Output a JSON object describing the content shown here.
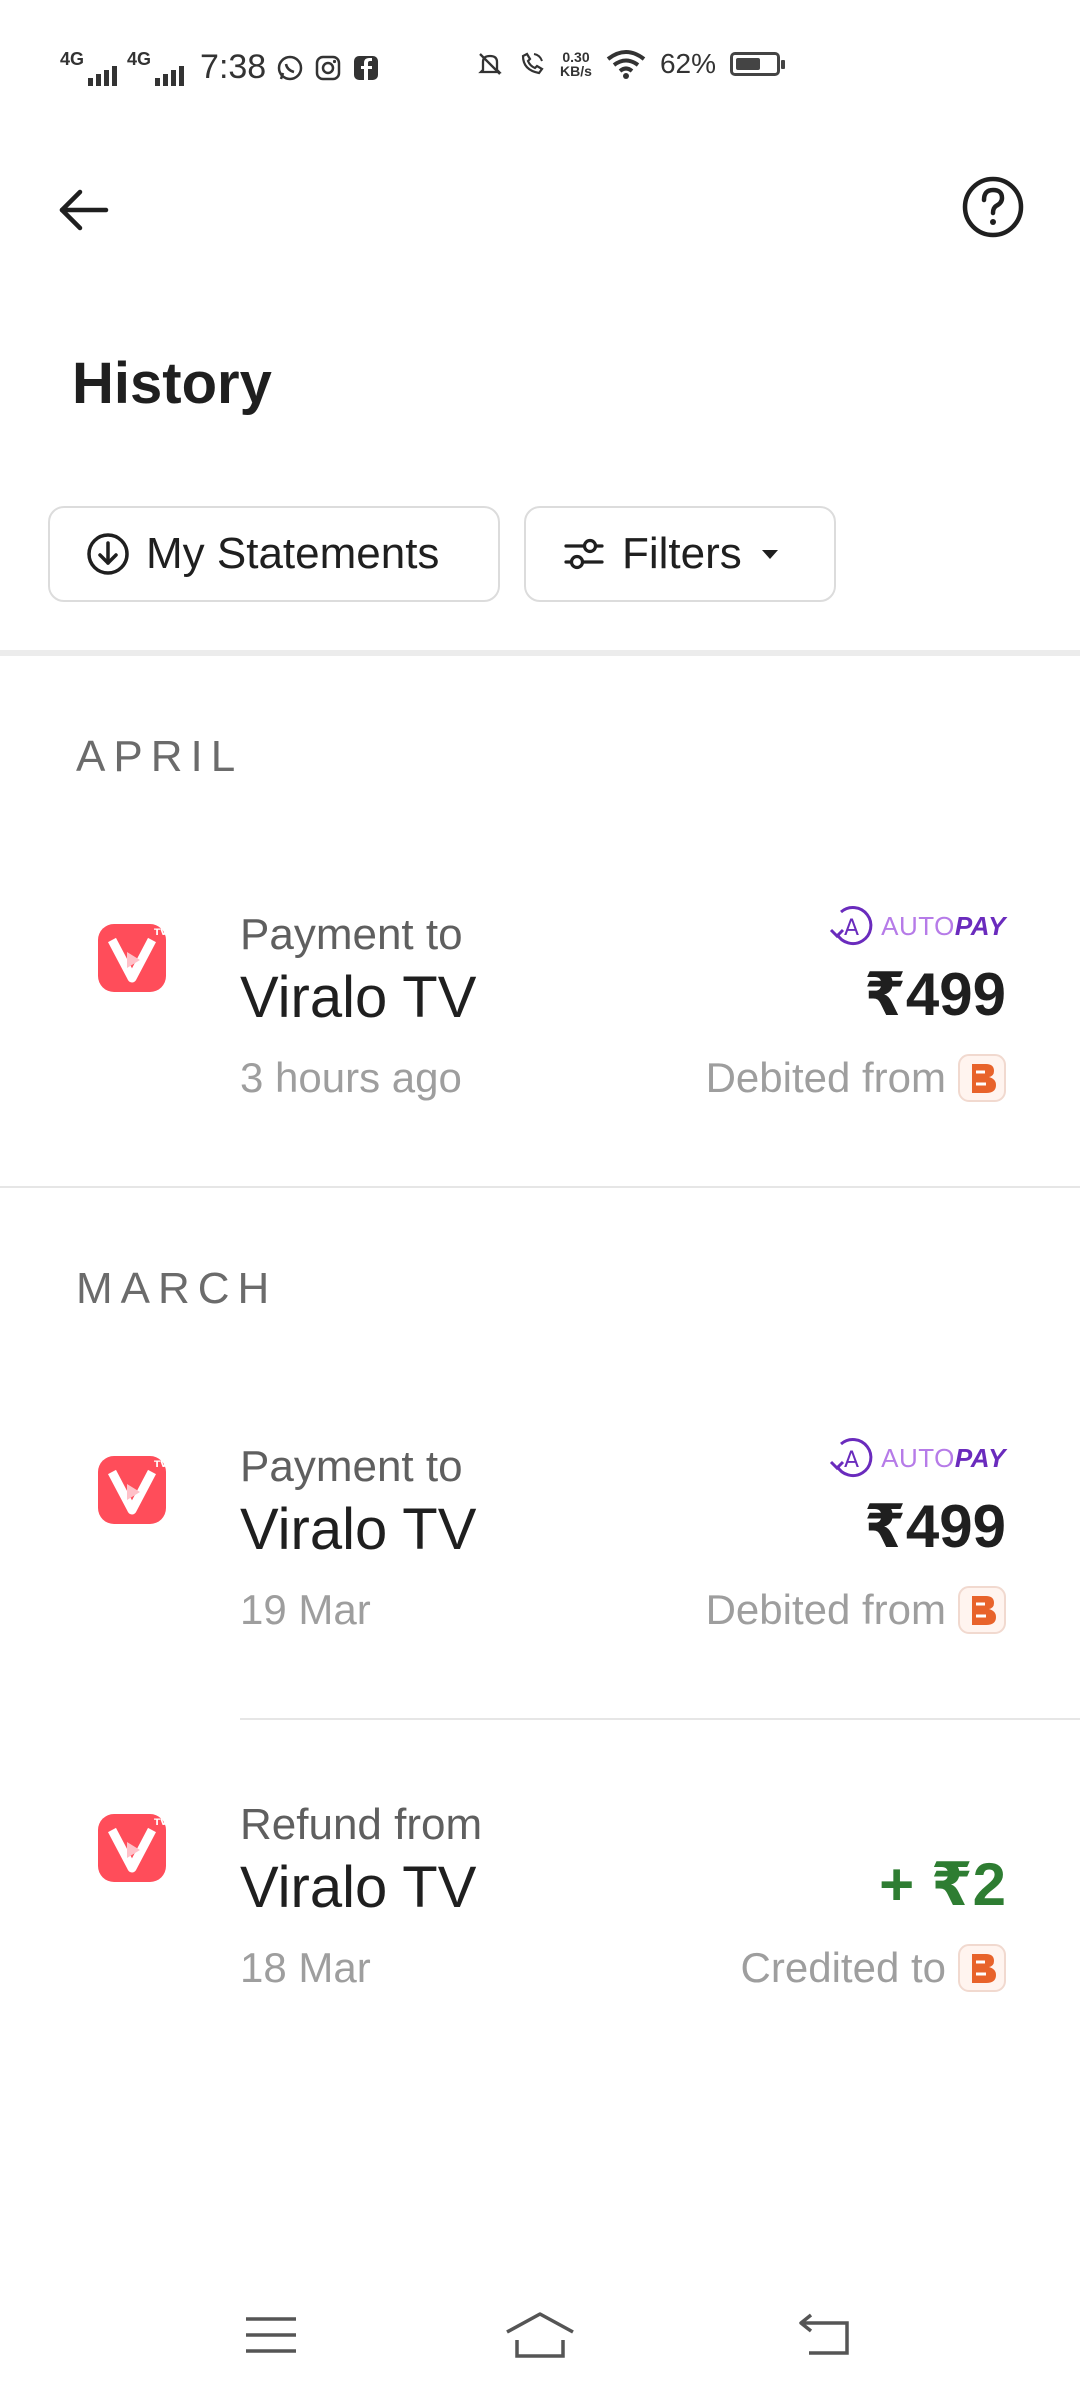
{
  "status_bar": {
    "network1": "4G",
    "network2": "4G",
    "time": "7:38",
    "speed_value": "0.30",
    "speed_unit": "KB/s",
    "battery_percent": "62%",
    "battery_level": 0.62,
    "icons": [
      "whatsapp-icon",
      "instagram-icon",
      "facebook-icon",
      "mute-icon",
      "wifi-call-icon",
      "wifi-icon",
      "battery-icon"
    ]
  },
  "header": {
    "title": "History"
  },
  "chips": {
    "statements_label": "My Statements",
    "filters_label": "Filters"
  },
  "sections": [
    {
      "month": "APRIL",
      "transactions": [
        {
          "kind": "Payment to",
          "merchant": "Viralo TV",
          "when": "3 hours ago",
          "badge_autopay_a": "AUTO",
          "badge_autopay_b": "PAY",
          "amount": "₹499",
          "account_label": "Debited from"
        }
      ]
    },
    {
      "month": "MARCH",
      "transactions": [
        {
          "kind": "Payment to",
          "merchant": "Viralo TV",
          "when": "19 Mar",
          "badge_autopay_a": "AUTO",
          "badge_autopay_b": "PAY",
          "amount": "₹499",
          "account_label": "Debited from"
        },
        {
          "kind": "Refund from",
          "merchant": "Viralo TV",
          "when": "18 Mar",
          "amount": "+ ₹2",
          "account_label": "Credited to"
        }
      ]
    }
  ],
  "colors": {
    "credit": "#2e7d32",
    "autopay_light": "#b67be8",
    "autopay_dark": "#6a2bbd",
    "merchant_logo": "#ff4d5a",
    "bank_logo": "#e8632b"
  }
}
